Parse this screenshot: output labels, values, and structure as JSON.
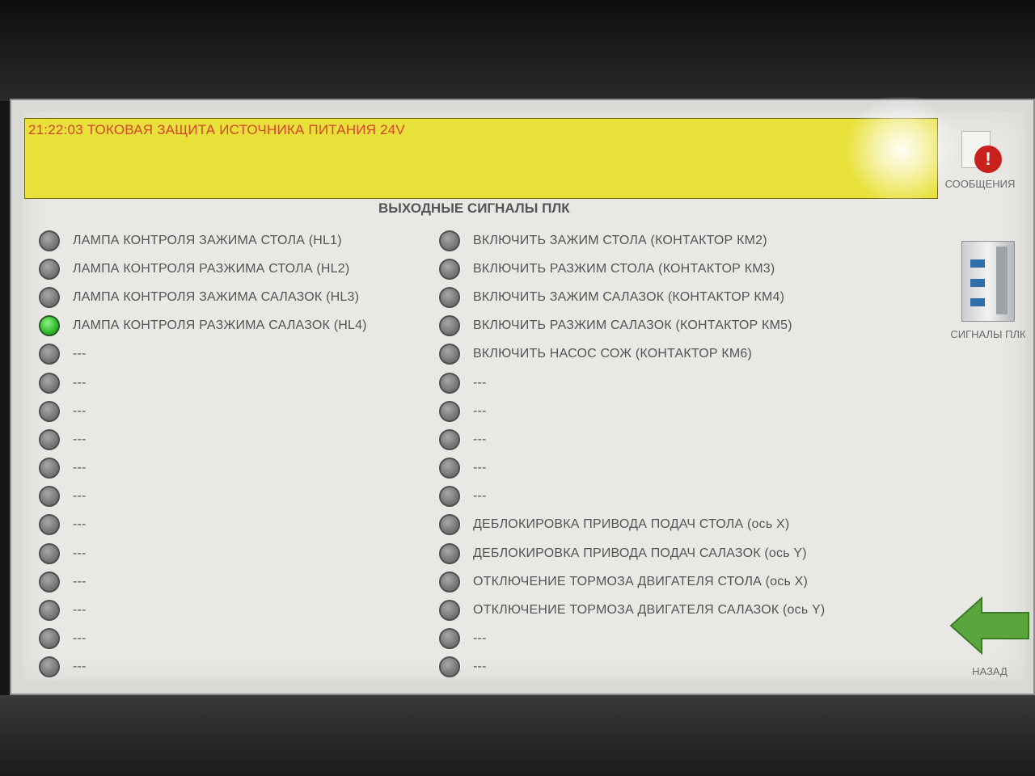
{
  "alarm": {
    "message": "21:22:03 ТОКОВАЯ ЗАЩИТА ИСТОЧНИКА ПИТАНИЯ 24V"
  },
  "page": {
    "title": "ВЫХОДНЫЕ СИГНАЛЫ ПЛК"
  },
  "signals_left": [
    {
      "label": "ЛАМПА КОНТРОЛЯ ЗАЖИМА СТОЛА (HL1)",
      "state": "off"
    },
    {
      "label": "ЛАМПА КОНТРОЛЯ РАЗЖИМА СТОЛА (HL2)",
      "state": "off"
    },
    {
      "label": "ЛАМПА КОНТРОЛЯ ЗАЖИМА САЛАЗОК (HL3)",
      "state": "off"
    },
    {
      "label": "ЛАМПА КОНТРОЛЯ РАЗЖИМА САЛАЗОК (HL4)",
      "state": "on"
    },
    {
      "label": "---",
      "state": "off"
    },
    {
      "label": "---",
      "state": "off"
    },
    {
      "label": "---",
      "state": "off"
    },
    {
      "label": "---",
      "state": "off"
    },
    {
      "label": "---",
      "state": "off"
    },
    {
      "label": "---",
      "state": "off"
    },
    {
      "label": "---",
      "state": "off"
    },
    {
      "label": "---",
      "state": "off"
    },
    {
      "label": "---",
      "state": "off"
    },
    {
      "label": "---",
      "state": "off"
    },
    {
      "label": "---",
      "state": "off"
    },
    {
      "label": "---",
      "state": "off"
    }
  ],
  "signals_right": [
    {
      "label": "ВКЛЮЧИТЬ ЗАЖИМ СТОЛА (КОНТАКТОР КМ2)",
      "state": "off"
    },
    {
      "label": "ВКЛЮЧИТЬ РАЗЖИМ СТОЛА (КОНТАКТОР КМ3)",
      "state": "off"
    },
    {
      "label": "ВКЛЮЧИТЬ ЗАЖИМ САЛАЗОК (КОНТАКТОР КМ4)",
      "state": "off"
    },
    {
      "label": "ВКЛЮЧИТЬ РАЗЖИМ САЛАЗОК (КОНТАКТОР КМ5)",
      "state": "off"
    },
    {
      "label": "ВКЛЮЧИТЬ НАСОС СОЖ (КОНТАКТОР КМ6)",
      "state": "off"
    },
    {
      "label": "---",
      "state": "off"
    },
    {
      "label": "---",
      "state": "off"
    },
    {
      "label": "---",
      "state": "off"
    },
    {
      "label": "---",
      "state": "off"
    },
    {
      "label": "---",
      "state": "off"
    },
    {
      "label": "ДЕБЛОКИРОВКА ПРИВОДА ПОДАЧ СТОЛА (ось X)",
      "state": "off"
    },
    {
      "label": "ДЕБЛОКИРОВКА ПРИВОДА ПОДАЧ САЛАЗОК (ось Y)",
      "state": "off"
    },
    {
      "label": "ОТКЛЮЧЕНИЕ ТОРМОЗА ДВИГАТЕЛЯ СТОЛА (ось X)",
      "state": "off"
    },
    {
      "label": "ОТКЛЮЧЕНИЕ ТОРМОЗА ДВИГАТЕЛЯ САЛАЗОК (ось Y)",
      "state": "off"
    },
    {
      "label": "---",
      "state": "off"
    },
    {
      "label": "---",
      "state": "off"
    }
  ],
  "sidebar": {
    "messages_label": "СООБЩЕНИЯ",
    "messages_icon": "message-alert-icon",
    "plc_signals_label": "СИГНАЛЫ ПЛК",
    "plc_signals_icon": "plc-device-icon",
    "back_label": "НАЗАД",
    "back_icon": "arrow-left-icon"
  },
  "colors": {
    "alarm_bg": "#e9e13a",
    "alarm_text": "#d2462a",
    "lamp_on": "#35c02e",
    "lamp_off": "#7c7c7c",
    "back_arrow": "#5aa63c"
  }
}
